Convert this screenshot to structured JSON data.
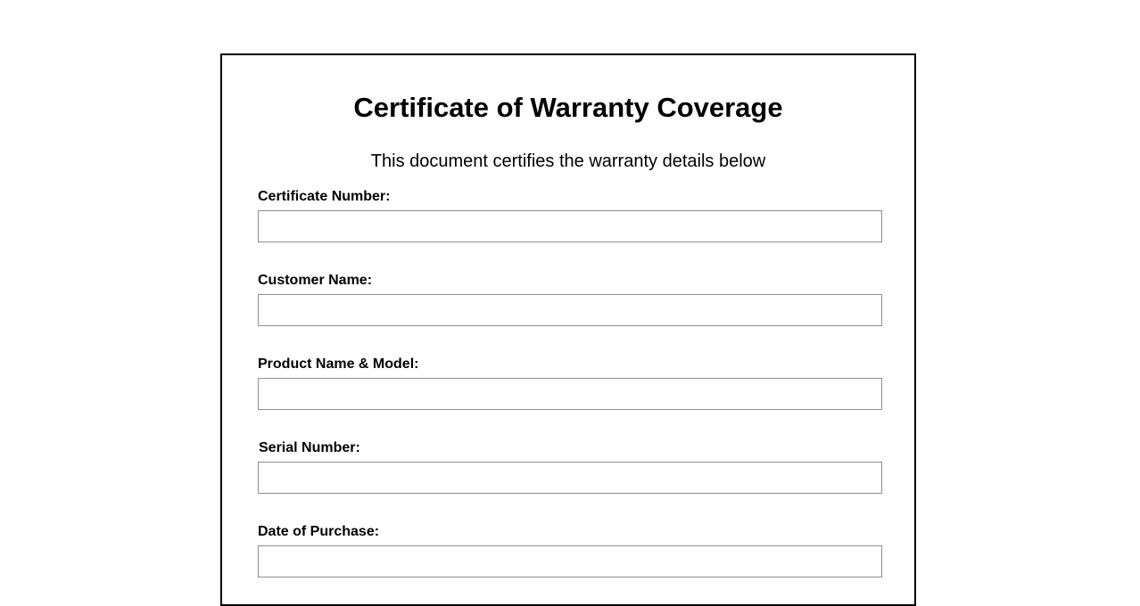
{
  "certificate": {
    "title": "Certificate of Warranty Coverage",
    "subtitle": "This document certifies the warranty details below",
    "fields": [
      {
        "label": "Certificate Number:",
        "value": "",
        "placeholder": ""
      },
      {
        "label": "Customer Name:",
        "value": "",
        "placeholder": ""
      },
      {
        "label": "Product Name & Model:",
        "value": "",
        "placeholder": ""
      },
      {
        "label": "Serial Number:",
        "value": "",
        "placeholder": ""
      },
      {
        "label": "Date of Purchase:",
        "value": "",
        "placeholder": ""
      }
    ]
  },
  "colors": {
    "border": "#000000",
    "input_border": "#8f8f8f",
    "background": "#ffffff"
  }
}
